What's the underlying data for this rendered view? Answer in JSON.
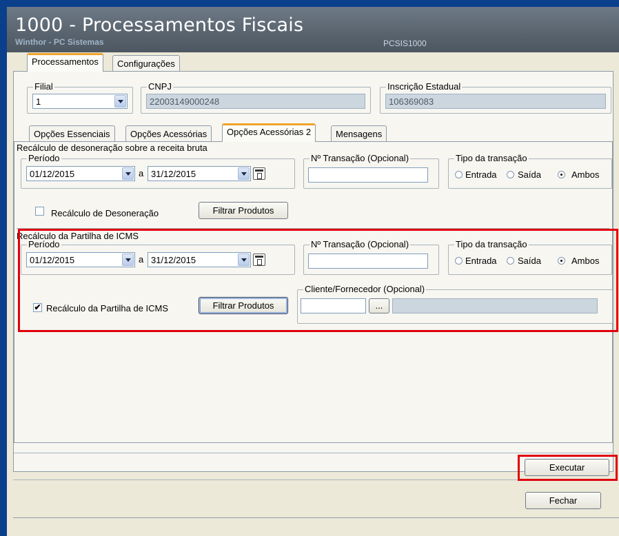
{
  "window": {
    "title": "1000 - Processamentos Fiscais",
    "subtitle": "Winthor - PC Sistemas",
    "code": "PCSIS1000"
  },
  "main_tabs": [
    {
      "label": "Processamentos",
      "active": true
    },
    {
      "label": "Configurações",
      "active": false
    }
  ],
  "filial": {
    "legend": "Filial",
    "value": "1"
  },
  "cnpj": {
    "legend": "CNPJ",
    "value": "22003149000248"
  },
  "ie": {
    "legend": "Inscrição Estadual",
    "value": "106369083"
  },
  "sub_tabs": [
    {
      "label": "Opções Essenciais",
      "active": false
    },
    {
      "label": "Opções Acessórias",
      "active": false
    },
    {
      "label": "Opções Acessórias 2",
      "active": true
    },
    {
      "label": "Mensagens",
      "active": false
    }
  ],
  "section1": {
    "title": "Recálculo de desoneração sobre a receita bruta",
    "periodo_legend": "Período",
    "date_from": "01/12/2015",
    "a_label": "a",
    "date_to": "31/12/2015",
    "transacao_legend": "Nº Transação (Opcional)",
    "transacao_value": "",
    "tipo_legend": "Tipo da transação",
    "radio_entrada": "Entrada",
    "radio_saida": "Saída",
    "radio_ambos": "Ambos",
    "selected": "Ambos",
    "checkbox_label": "Recálculo de Desoneração",
    "checkbox_checked": false,
    "filtrar_button": "Filtrar Produtos"
  },
  "section2": {
    "title": "Recálculo da Partilha de ICMS",
    "periodo_legend": "Período",
    "date_from": "01/12/2015",
    "a_label": "a",
    "date_to": "31/12/2015",
    "transacao_legend": "Nº Transação (Opcional)",
    "transacao_value": "",
    "tipo_legend": "Tipo da transação",
    "radio_entrada": "Entrada",
    "radio_saida": "Saída",
    "radio_ambos": "Ambos",
    "selected": "Ambos",
    "checkbox_label": "Recálculo da Partilha de ICMS",
    "checkbox_checked": true,
    "filtrar_button": "Filtrar Produtos",
    "cliente_legend": "Cliente/Fornecedor (Opcional)",
    "cliente_code": "",
    "cliente_browse": "...",
    "cliente_name": ""
  },
  "buttons": {
    "executar": "Executar",
    "fechar": "Fechar"
  },
  "colors": {
    "highlight": "#e0000e",
    "title_bar": "#58636e",
    "window_frame": "#0a3f8c",
    "tab_accent": "#f0a42a"
  }
}
